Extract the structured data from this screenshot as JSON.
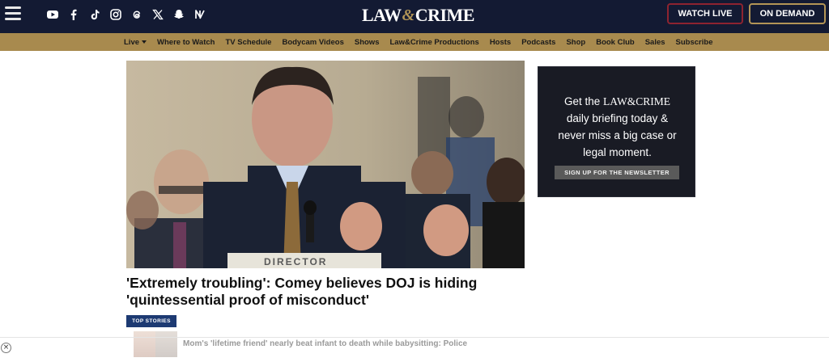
{
  "header": {
    "logo_left": "LAW",
    "logo_amp": "&",
    "logo_right": "CRIME",
    "watch_live": "WATCH LIVE",
    "on_demand": "ON DEMAND",
    "socials": [
      "youtube-icon",
      "facebook-icon",
      "tiktok-icon",
      "instagram-icon",
      "threads-icon",
      "x-icon",
      "snapchat-icon",
      "newsbreak-icon"
    ]
  },
  "nav": {
    "items": [
      "Live",
      "Where to Watch",
      "TV Schedule",
      "Bodycam Videos",
      "Shows",
      "Law&Crime Productions",
      "Hosts",
      "Podcasts",
      "Shop",
      "Book Club",
      "Sales",
      "Subscribe"
    ]
  },
  "hero": {
    "placard": "DIRECTOR",
    "headline": "'Extremely troubling': Comey believes DOJ is hiding 'quintessential proof of misconduct'"
  },
  "newsletter": {
    "line1_a": "Get the ",
    "logo": "LAW&CRIME",
    "line2": "daily briefing today &",
    "line3": "never miss a big case or",
    "line4": "legal moment.",
    "button": "SIGN UP FOR THE NEWSLETTER"
  },
  "top_stories": {
    "label": "TOP STORIES",
    "item_text": "Mom's 'lifetime friend' nearly beat infant to death while babysitting: Police"
  },
  "ad": {
    "close": "×"
  },
  "colors": {
    "header_bg": "#131a33",
    "nav_bg": "#a88a4e",
    "accent_red": "#8e2330",
    "accent_gold": "#b39556",
    "top_stories_blue": "#1d3a72"
  }
}
